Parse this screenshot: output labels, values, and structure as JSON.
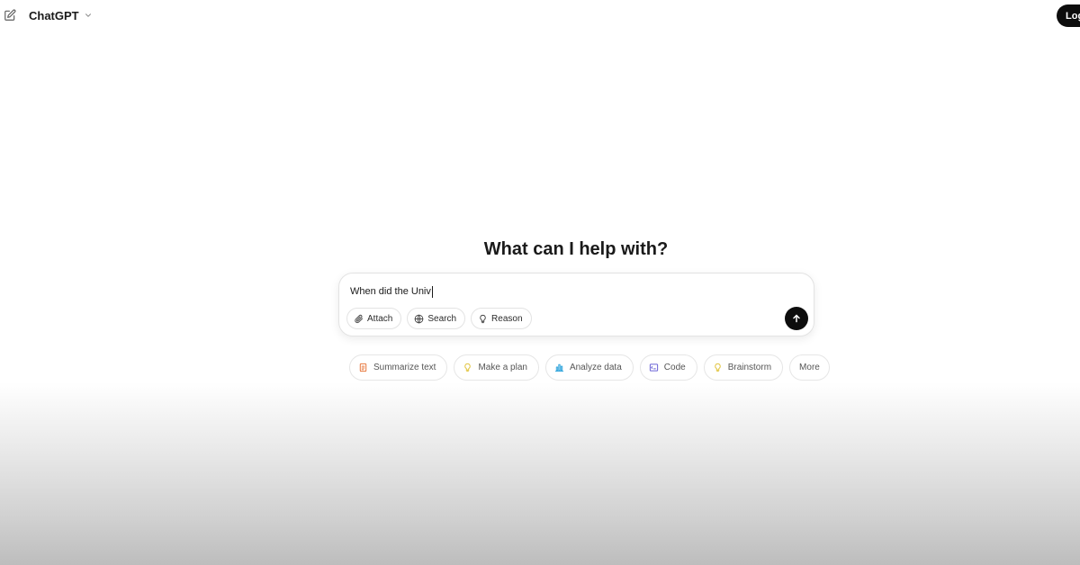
{
  "header": {
    "model_name": "ChatGPT",
    "login_label": "Log in",
    "icons": {
      "new_chat": "pencil-square-icon",
      "dropdown": "chevron-down-icon"
    }
  },
  "main": {
    "headline": "What can I help with?"
  },
  "composer": {
    "input_value": "When did the Univ",
    "tools": [
      {
        "label": "Attach",
        "icon": "paperclip-icon"
      },
      {
        "label": "Search",
        "icon": "globe-icon"
      },
      {
        "label": "Reason",
        "icon": "lightbulb-icon"
      }
    ],
    "send_icon": "arrow-up-icon"
  },
  "suggestions": [
    {
      "label": "Summarize text",
      "icon": "document-icon",
      "color": "#e8793f"
    },
    {
      "label": "Make a plan",
      "icon": "lightbulb-icon",
      "color": "#e2c541"
    },
    {
      "label": "Analyze data",
      "icon": "bar-chart-icon",
      "color": "#35a7dd"
    },
    {
      "label": "Code",
      "icon": "code-icon",
      "color": "#6b63d6"
    },
    {
      "label": "Brainstorm",
      "icon": "lightbulb-icon",
      "color": "#e2c541"
    },
    {
      "label": "More",
      "icon": "",
      "color": ""
    }
  ],
  "colors": {
    "primary": "#0d0d0d",
    "border": "#e3e3e3"
  }
}
